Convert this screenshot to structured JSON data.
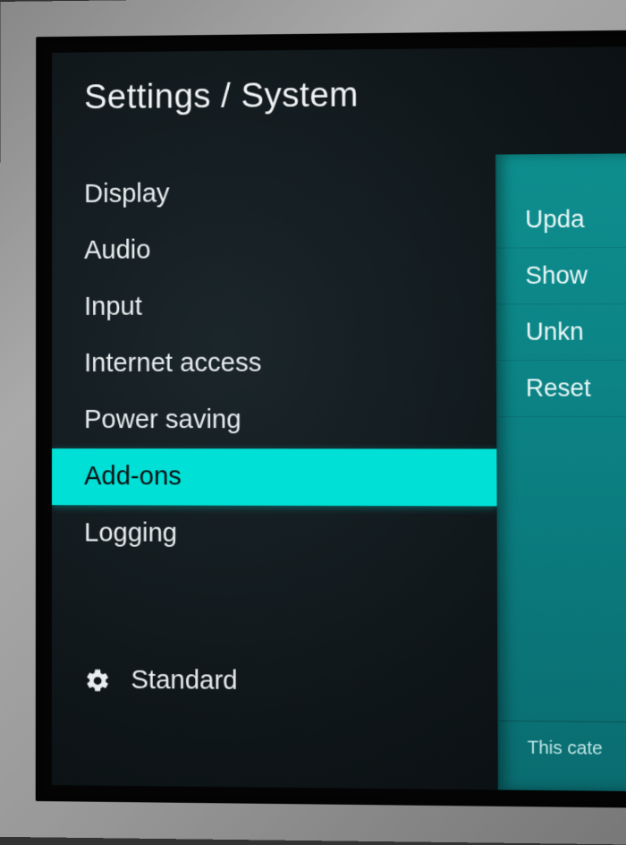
{
  "breadcrumb": "Settings / System",
  "sidebar": {
    "items": [
      {
        "label": "Display",
        "selected": false
      },
      {
        "label": "Audio",
        "selected": false
      },
      {
        "label": "Input",
        "selected": false
      },
      {
        "label": "Internet access",
        "selected": false
      },
      {
        "label": "Power saving",
        "selected": false
      },
      {
        "label": "Add-ons",
        "selected": true
      },
      {
        "label": "Logging",
        "selected": false
      }
    ],
    "level_label": "Standard"
  },
  "rightPanel": {
    "items": [
      {
        "label": "Upda"
      },
      {
        "label": "Show"
      },
      {
        "label": "Unkn"
      },
      {
        "label": "Reset"
      }
    ],
    "description": "This cate"
  }
}
